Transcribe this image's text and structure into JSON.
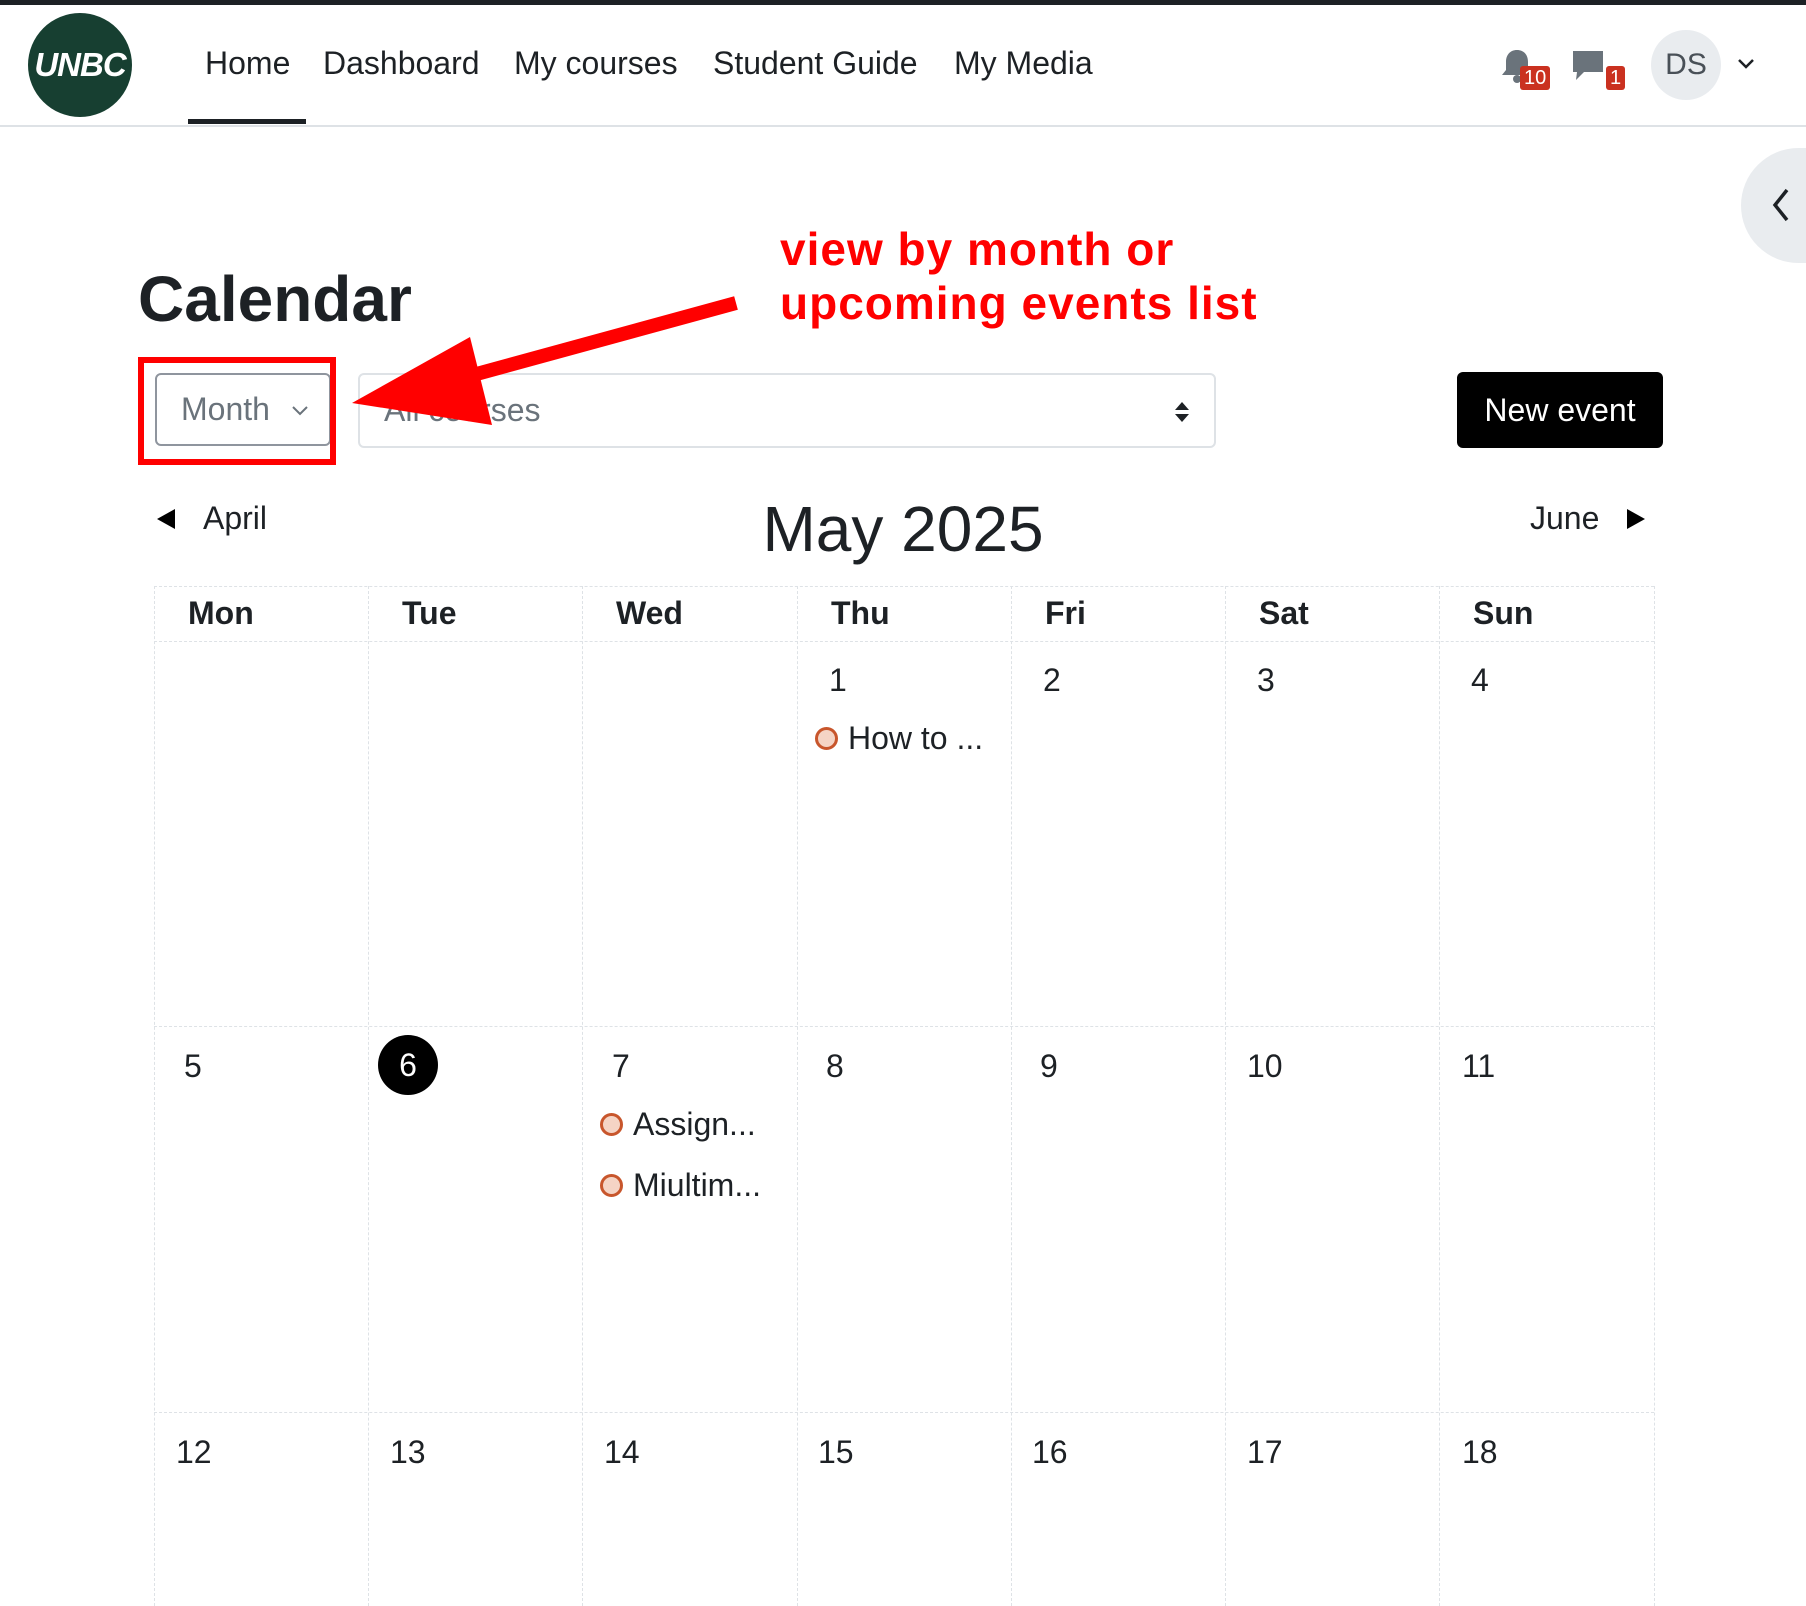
{
  "logo_text": "UNBC",
  "nav": {
    "items": [
      "Home",
      "Dashboard",
      "My courses",
      "Student Guide",
      "My Media"
    ],
    "notifications_count": "10",
    "messages_count": "1",
    "user_initials": "DS"
  },
  "page_title": "Calendar",
  "annotation": {
    "line1": "view by month or",
    "line2": "upcoming events list"
  },
  "controls": {
    "view_selected": "Month",
    "course_selected": "All courses",
    "new_event_label": "New event"
  },
  "month_nav": {
    "prev": "April",
    "current": "May 2025",
    "next": "June"
  },
  "calendar": {
    "weekdays": [
      "Mon",
      "Tue",
      "Wed",
      "Thu",
      "Fri",
      "Sat",
      "Sun"
    ],
    "weeks": [
      [
        "",
        "",
        "",
        "1",
        "2",
        "3",
        "4"
      ],
      [
        "5",
        "6",
        "7",
        "8",
        "9",
        "10",
        "11"
      ],
      [
        "12",
        "13",
        "14",
        "15",
        "16",
        "17",
        "18"
      ]
    ],
    "today": "6",
    "events": [
      {
        "day": "1",
        "title": "How to ..."
      },
      {
        "day": "7",
        "title": "Assign..."
      },
      {
        "day": "7",
        "title": "Miultim..."
      }
    ]
  },
  "colors": {
    "accent_red": "#ff0000",
    "logo_green": "#173f31",
    "badge_red": "#ca3120",
    "event_dot": "#c8562c"
  }
}
